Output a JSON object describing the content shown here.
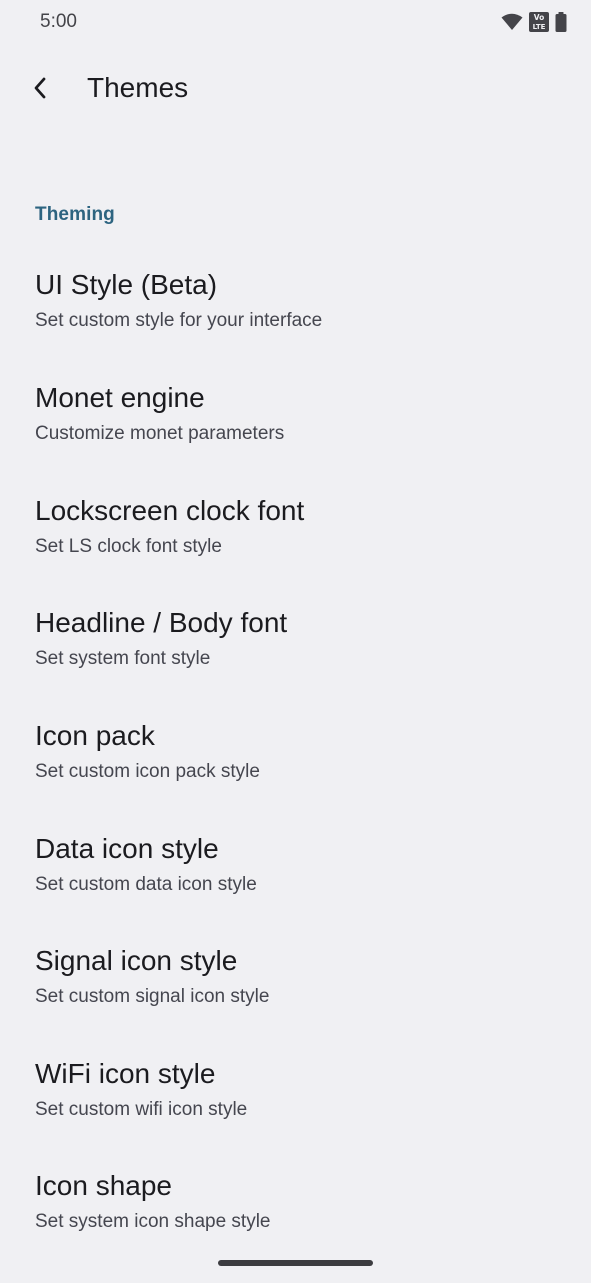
{
  "status_bar": {
    "time": "5:00",
    "icons": [
      "wifi-icon",
      "volte-icon",
      "battery-icon"
    ],
    "volte_label_top": "Vo",
    "volte_label_bottom": "LTE"
  },
  "app_bar": {
    "back_icon": "back-arrow-icon",
    "title": "Themes"
  },
  "section": {
    "title": "Theming",
    "color": "#2d6480"
  },
  "items": [
    {
      "title": "UI Style (Beta)",
      "summary": "Set custom style for your interface"
    },
    {
      "title": "Monet engine",
      "summary": "Customize monet parameters"
    },
    {
      "title": "Lockscreen clock font",
      "summary": "Set LS clock font style"
    },
    {
      "title": "Headline / Body font",
      "summary": "Set system font style"
    },
    {
      "title": "Icon pack",
      "summary": "Set custom icon pack style"
    },
    {
      "title": "Data icon style",
      "summary": "Set custom data icon style"
    },
    {
      "title": "Signal icon style",
      "summary": "Set custom signal icon style"
    },
    {
      "title": "WiFi icon style",
      "summary": "Set custom wifi icon style"
    },
    {
      "title": "Icon shape",
      "summary": "Set system icon shape style"
    }
  ]
}
